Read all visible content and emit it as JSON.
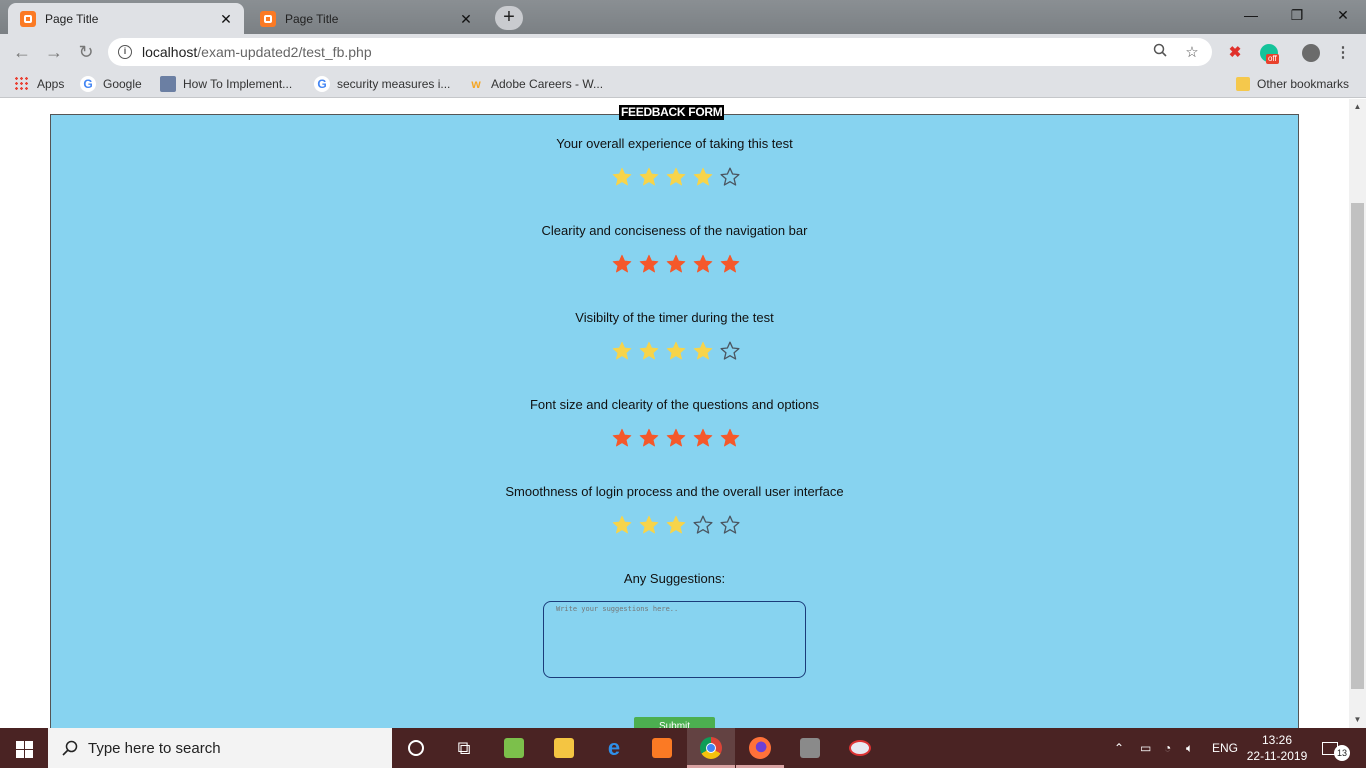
{
  "browser": {
    "tabs": [
      {
        "title": "Page Title",
        "active": true
      },
      {
        "title": "Page Title",
        "active": false
      }
    ],
    "new_tab": "+",
    "window_controls": {
      "minimize": "—",
      "restore": "❐",
      "close": "✕"
    },
    "url_host": "localhost",
    "url_path": "/exam-updated2/test_fb.php",
    "extension_badge": "off",
    "bookmarks": [
      {
        "label": "Apps",
        "icon": "apps-grid-icon"
      },
      {
        "label": "Google",
        "icon": "google-icon"
      },
      {
        "label": "How To Implement...",
        "icon": "page-icon"
      },
      {
        "label": "security measures i...",
        "icon": "google-icon"
      },
      {
        "label": "Adobe Careers - W...",
        "icon": "workday-icon"
      }
    ],
    "other_bookmarks": "Other bookmarks"
  },
  "form": {
    "title": "FEEDBACK FORM",
    "questions": [
      {
        "text": "Your overall experience of taking this test",
        "rating": 4,
        "max": 5,
        "color": "#f7d44a"
      },
      {
        "text": "Clearity and conciseness of the navigation bar",
        "rating": 5,
        "max": 5,
        "color": "#f5582a"
      },
      {
        "text": "Visibilty of the timer during the test",
        "rating": 4,
        "max": 5,
        "color": "#f7d44a"
      },
      {
        "text": "Font size and clearity of the questions and options",
        "rating": 5,
        "max": 5,
        "color": "#f5582a"
      },
      {
        "text": "Smoothness of login process and the overall user interface",
        "rating": 3,
        "max": 5,
        "color": "#f7d44a"
      }
    ],
    "suggestions_label": "Any Suggestions:",
    "suggestions_placeholder": "Write your suggestions here..",
    "submit_label": "Submit"
  },
  "taskbar": {
    "search_placeholder": "Type here to search",
    "language": "ENG",
    "time": "13:26",
    "date": "22-11-2019",
    "notification_count": "13"
  },
  "colors": {
    "form_bg": "#87d3f0",
    "star_full_yellow": "#f7d44a",
    "star_full_orange": "#f5582a",
    "submit_bg": "#4caf50",
    "taskbar_bg": "#4a2323"
  }
}
